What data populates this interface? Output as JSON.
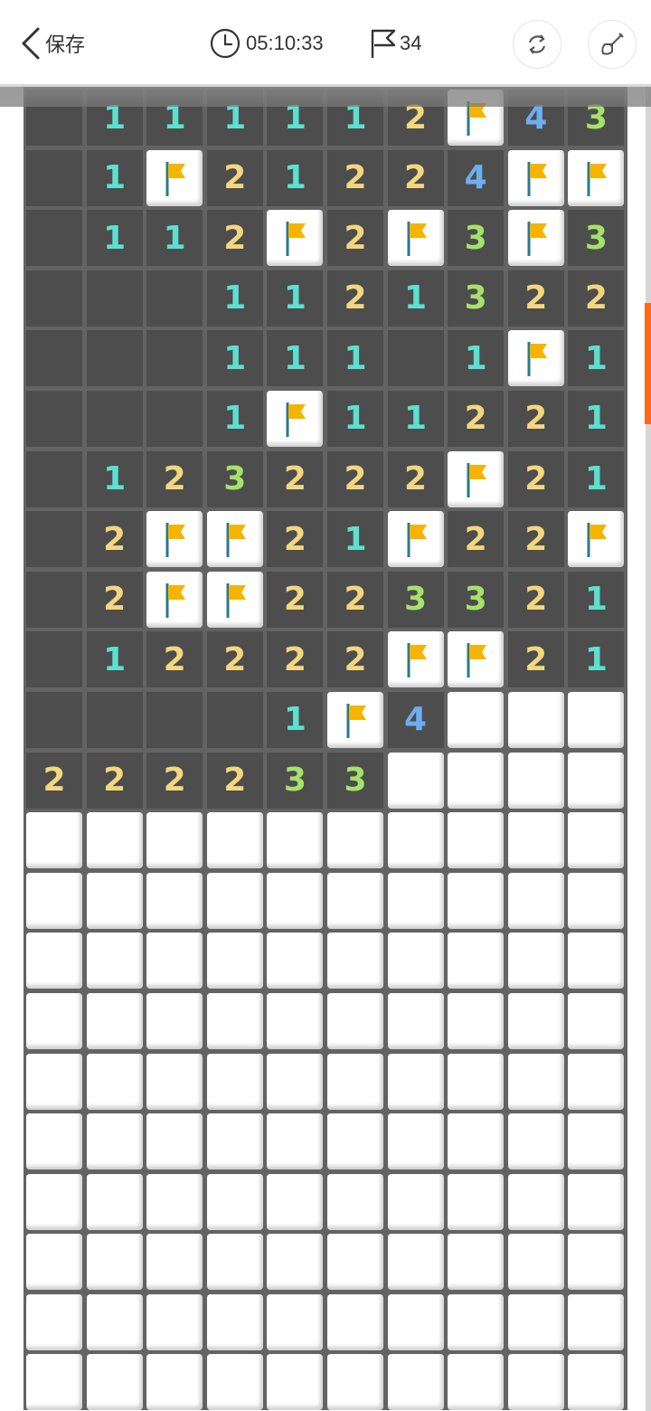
{
  "header": {
    "back_label": "保存",
    "timer": "05:10:33",
    "flags_count": "34",
    "icons": {
      "back": "chevron-left-icon",
      "timer": "clock-icon",
      "flags": "flag-outline-icon",
      "refresh": "refresh-icon",
      "hint": "shovel-icon"
    }
  },
  "colors": {
    "num1": "#5ce0d0",
    "num2": "#f3d67e",
    "num3": "#a5e26a",
    "num4": "#6eaef0",
    "flag": "#f5b400",
    "scroll_accent": "#ff6a1a"
  },
  "board": {
    "columns": 10,
    "rows": [
      [
        "",
        "1",
        "1",
        "1",
        "1",
        "1",
        "2",
        "F",
        "4",
        "3"
      ],
      [
        "",
        "1",
        "F",
        "2",
        "1",
        "2",
        "2",
        "4",
        "F",
        "F"
      ],
      [
        "",
        "1",
        "1",
        "2",
        "F",
        "2",
        "F",
        "3",
        "F",
        "3"
      ],
      [
        "",
        "",
        "",
        "1",
        "1",
        "2",
        "1",
        "3",
        "2",
        "2"
      ],
      [
        "",
        "",
        "",
        "1",
        "1",
        "1",
        "",
        "1",
        "F",
        "1"
      ],
      [
        "",
        "",
        "",
        "1",
        "F",
        "1",
        "1",
        "2",
        "2",
        "1"
      ],
      [
        "",
        "1",
        "2",
        "3",
        "2",
        "2",
        "2",
        "F",
        "2",
        "1"
      ],
      [
        "",
        "2",
        "F",
        "F",
        "2",
        "1",
        "F",
        "2",
        "2",
        "F"
      ],
      [
        "",
        "2",
        "F",
        "F",
        "2",
        "2",
        "3",
        "3",
        "2",
        "1"
      ],
      [
        "",
        "1",
        "2",
        "2",
        "2",
        "2",
        "F",
        "F",
        "2",
        "1"
      ],
      [
        "",
        "",
        "",
        "",
        "1",
        "F",
        "4",
        "H",
        "H",
        "H"
      ],
      [
        "2",
        "2",
        "2",
        "2",
        "3",
        "3",
        "H",
        "H",
        "H",
        "H"
      ],
      [
        "H",
        "H",
        "H",
        "H",
        "H",
        "H",
        "H",
        "H",
        "H",
        "H"
      ],
      [
        "H",
        "H",
        "H",
        "H",
        "H",
        "H",
        "H",
        "H",
        "H",
        "H"
      ],
      [
        "H",
        "H",
        "H",
        "H",
        "H",
        "H",
        "H",
        "H",
        "H",
        "H"
      ],
      [
        "H",
        "H",
        "H",
        "H",
        "H",
        "H",
        "H",
        "H",
        "H",
        "H"
      ],
      [
        "H",
        "H",
        "H",
        "H",
        "H",
        "H",
        "H",
        "H",
        "H",
        "H"
      ],
      [
        "H",
        "H",
        "H",
        "H",
        "H",
        "H",
        "H",
        "H",
        "H",
        "H"
      ],
      [
        "H",
        "H",
        "H",
        "H",
        "H",
        "H",
        "H",
        "H",
        "H",
        "H"
      ],
      [
        "H",
        "H",
        "H",
        "H",
        "H",
        "H",
        "H",
        "H",
        "H",
        "H"
      ],
      [
        "H",
        "H",
        "H",
        "H",
        "H",
        "H",
        "H",
        "H",
        "H",
        "H"
      ],
      [
        "H",
        "H",
        "H",
        "H",
        "H",
        "H",
        "H",
        "H",
        "H",
        "H"
      ]
    ]
  }
}
